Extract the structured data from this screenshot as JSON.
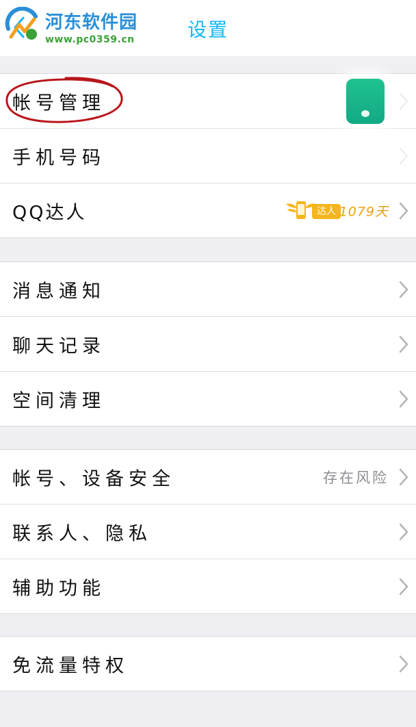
{
  "header": {
    "title": "设置"
  },
  "watermark": {
    "site_name": "河东软件园",
    "url": "www.pc0359.cn"
  },
  "groups": [
    {
      "items": [
        {
          "label": "帐号管理",
          "annotated": true
        },
        {
          "label": "手机号码"
        },
        {
          "label": "QQ达人",
          "badge": "达人",
          "value": "1079天"
        }
      ]
    },
    {
      "items": [
        {
          "label": "消息通知"
        },
        {
          "label": "聊天记录"
        },
        {
          "label": "空间清理"
        }
      ]
    },
    {
      "items": [
        {
          "label": "帐号、设备安全",
          "value": "存在风险"
        },
        {
          "label": "联系人、隐私"
        },
        {
          "label": "辅助功能"
        }
      ]
    },
    {
      "items": [
        {
          "label": "免流量特权"
        }
      ]
    }
  ],
  "colors": {
    "accent": "#12b7f5",
    "background": "#efeff4",
    "annotation": "#b8161c",
    "daren": "#f5b51c"
  },
  "icons": {
    "back": "back-arrow-icon",
    "chevron": "chevron-right-icon",
    "daren_wings": "daren-wings-icon"
  }
}
